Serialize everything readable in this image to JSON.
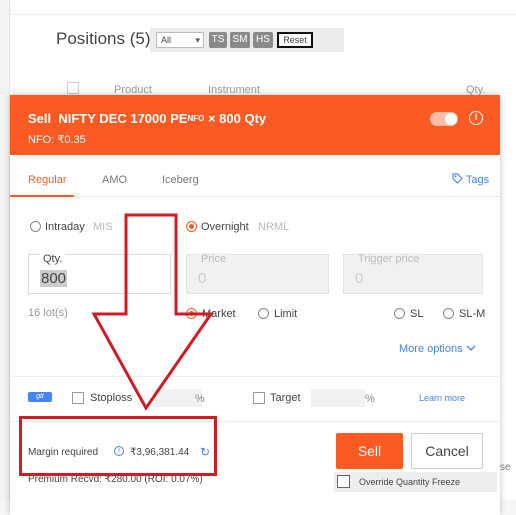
{
  "background": {
    "title": "Positions (5)",
    "filter_select": "All",
    "filter_buttons": [
      "TS",
      "SM",
      "HS"
    ],
    "reset_label": "Reset",
    "columns": [
      "Product",
      "Instrument",
      "Qty."
    ]
  },
  "order": {
    "side": "Sell",
    "instrument": "NIFTY DEC 17000 PE",
    "exchange_tag": "NFO",
    "qty_suffix": "× 800 Qty",
    "price_line": "NFO: ₹0.35",
    "tabs": [
      "Regular",
      "AMO",
      "Iceberg"
    ],
    "tags_label": "Tags",
    "product": {
      "intraday": "Intraday",
      "intraday_code": "MIS",
      "overnight": "Overnight",
      "overnight_code": "NRML"
    },
    "fields": {
      "qty_label": "Qty.",
      "qty_value": "800",
      "price_label": "Price",
      "price_value": "0",
      "trigger_label": "Trigger price",
      "trigger_value": "0"
    },
    "lots": "16 lot(s)",
    "order_types": [
      "Market",
      "Limit",
      "SL",
      "SL-M"
    ],
    "more_options": "More options",
    "gtt_label": "gtt",
    "stoploss_label": "Stoploss",
    "target_label": "Target",
    "percent": "%",
    "learn_more": "Learn more",
    "margin_label": "Margin required",
    "margin_value": "₹3,96,381.44",
    "premium": "Premium Recvd: ₹280.00 (ROI: 0.07%)",
    "sell_button": "Sell",
    "cancel_button": "Cancel",
    "override_label": "Override Quantity Freeze"
  },
  "page_edge_text": "se",
  "colors": {
    "accent": "#fb5a23",
    "link": "#4184f3",
    "annotation": "#d01c24"
  }
}
